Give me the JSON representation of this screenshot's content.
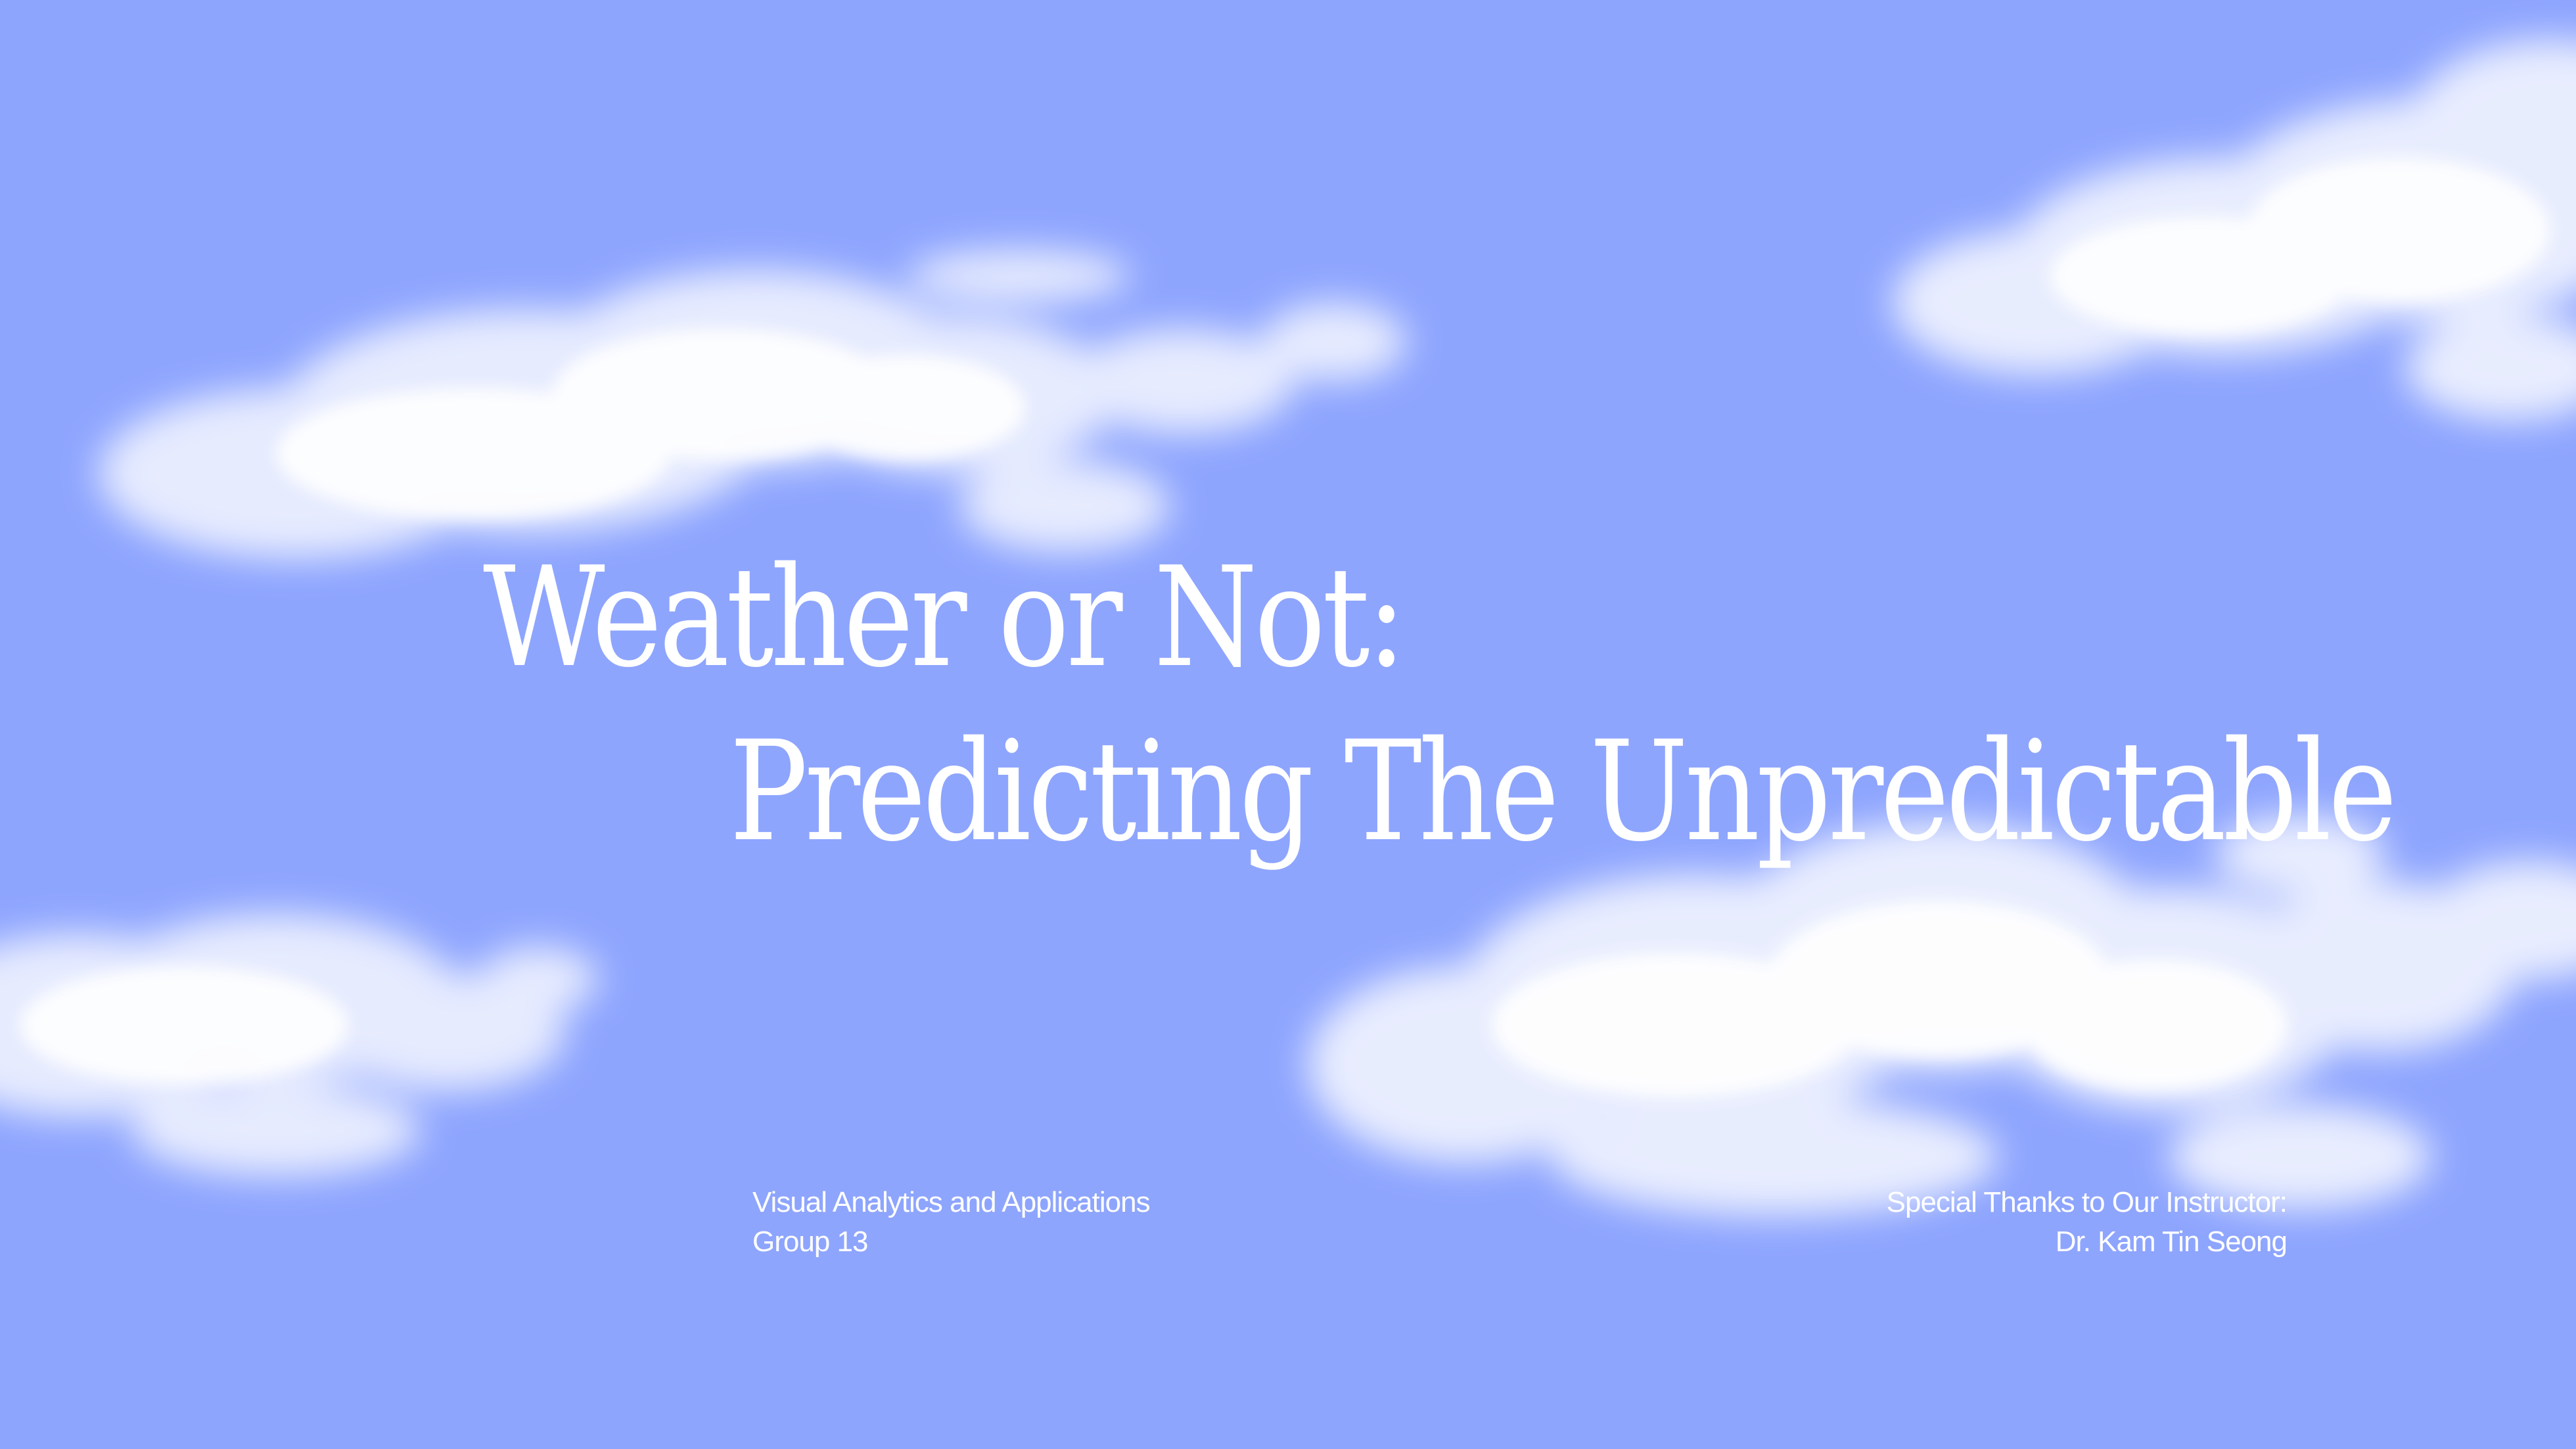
{
  "slide": {
    "background_color": "#8ea5fe",
    "title_line_1": "Weather or Not:",
    "title_line_2": "Predicting The Unpredictable",
    "course": {
      "name": "Visual Analytics and Applications",
      "group": "Group 13"
    },
    "acknowledgement": {
      "heading": "Special Thanks to Our Instructor:",
      "instructor": "Dr. Kam Tin Seong"
    }
  }
}
